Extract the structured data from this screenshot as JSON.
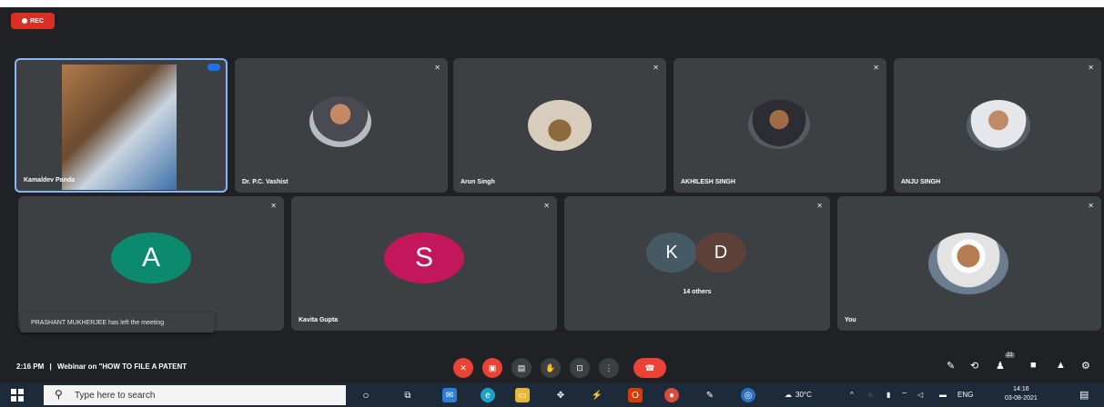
{
  "recording_badge": "REC",
  "tiles": [
    {
      "name": "Kamaldev Panda",
      "active": true
    },
    {
      "name": "Dr. P.C. Vashist"
    },
    {
      "name": "Arun Singh"
    },
    {
      "name": "AKHILESH SINGH"
    },
    {
      "name": "ANJU SINGH"
    },
    {
      "name": "",
      "initial": "A",
      "color": "#0b8a6e"
    },
    {
      "name": "Kavita Gupta",
      "initial": "S",
      "color": "#c2185b"
    },
    {
      "name": "14 others",
      "initials": [
        "K",
        "D"
      ],
      "colors": [
        "#455a64",
        "#5d4037"
      ]
    },
    {
      "name": "You"
    }
  ],
  "notification": "PRASHANT MUKHERJEE has left the meeting",
  "meeting": {
    "time": "2:16 PM",
    "separator": "|",
    "title": "Webinar on \"HOW TO FILE A PATENT"
  },
  "controls": [
    "mic-off-icon",
    "camera-off-icon",
    "captions-icon",
    "raise-hand-icon",
    "present-icon",
    "more-options-icon",
    "end-call-icon"
  ],
  "right_controls": [
    "info-icon",
    "chat-icon",
    "people-icon",
    "chat-bubble-icon",
    "activities-icon",
    "host-controls-icon"
  ],
  "people_count": "22",
  "taskbar": {
    "search_placeholder": "Type here to search",
    "weather": "30°C",
    "language": "ENG",
    "time": "14:16",
    "date": "03-08-2021"
  }
}
